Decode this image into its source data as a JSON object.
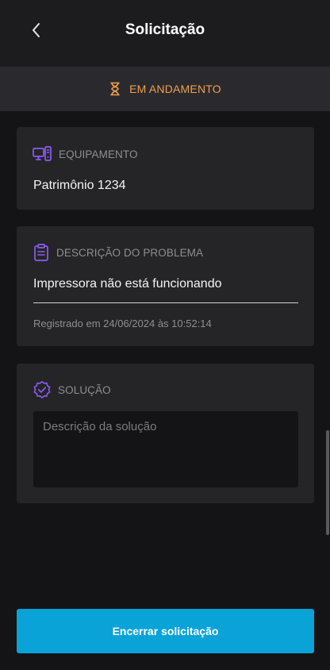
{
  "header": {
    "title": "Solicitação",
    "back_icon": "chevron-left-icon"
  },
  "status": {
    "label": "EM ANDAMENTO",
    "icon": "hourglass-icon",
    "color": "#f0a04b"
  },
  "equipment": {
    "label": "EQUIPAMENTO",
    "value": "Patrimônio 1234",
    "icon": "computer-icon"
  },
  "problem": {
    "label": "DESCRIÇÃO DO PROBLEMA",
    "value": "Impressora não está funcionando",
    "registered": "Registrado em 24/06/2024 às 10:52:14",
    "icon": "clipboard-icon"
  },
  "solution": {
    "label": "SOLUÇÃO",
    "placeholder": "Descrição da solução",
    "value": "",
    "icon": "verified-badge-icon"
  },
  "actions": {
    "close_label": "Encerrar solicitação"
  },
  "colors": {
    "accent": "#8b5cf6",
    "primary_button": "#0aa3d7",
    "background": "#141416",
    "card": "#252527"
  }
}
